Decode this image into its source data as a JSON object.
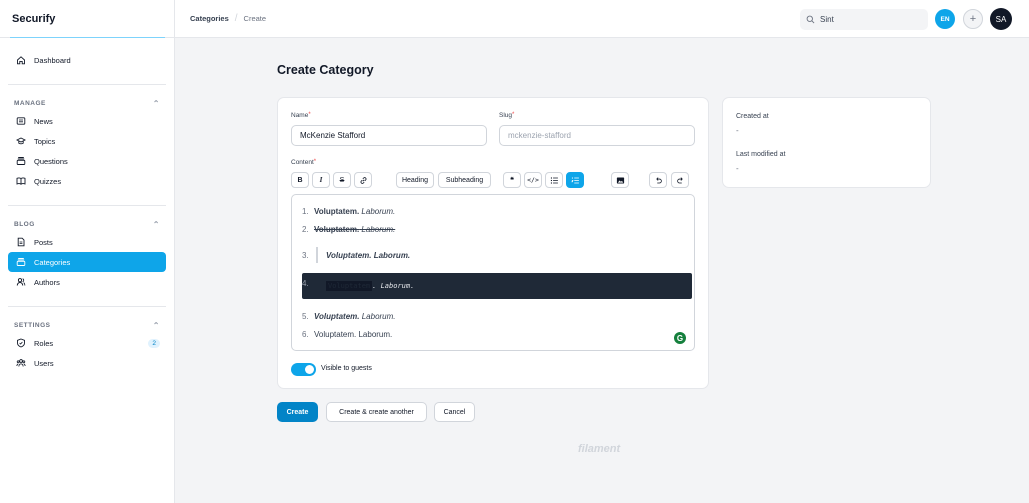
{
  "app": {
    "brand": "Securify"
  },
  "sidebar": {
    "dashboard": "Dashboard",
    "groups": [
      {
        "title": "MANAGE",
        "items": [
          "News",
          "Topics",
          "Questions",
          "Quizzes"
        ]
      },
      {
        "title": "BLOG",
        "items": [
          "Posts",
          "Categories",
          "Authors"
        ]
      },
      {
        "title": "SETTINGS",
        "items": [
          "Roles",
          "Users"
        ]
      }
    ],
    "roles_badge": "2"
  },
  "topbar": {
    "breadcrumb": [
      "Categories",
      "Create"
    ],
    "search_value": "Sint",
    "lang": "EN",
    "avatar": "SA"
  },
  "page": {
    "title": "Create Category"
  },
  "form": {
    "name_label": "Name",
    "name_value": "McKenzie Stafford",
    "slug_label": "Slug",
    "slug_placeholder": "mckenzie-stafford",
    "content_label": "Content",
    "toolbar": {
      "heading": "Heading",
      "subheading": "Subheading"
    },
    "content_items": {
      "bold": "Voluptatem.",
      "italic": "Laborum.",
      "full": "Voluptatem. Laborum.",
      "code_hl": "Voluptatem",
      "code_rest": ". Laborum."
    },
    "visible_label": "Visible to guests",
    "visible_on": true
  },
  "meta": {
    "created_label": "Created at",
    "created_value": "-",
    "modified_label": "Last modified at",
    "modified_value": "-"
  },
  "actions": {
    "create": "Create",
    "create_another": "Create & create another",
    "cancel": "Cancel"
  },
  "footer": {
    "mark": "filament"
  },
  "colors": {
    "accent": "#0ea5e9",
    "primary_button": "#0284c7"
  }
}
